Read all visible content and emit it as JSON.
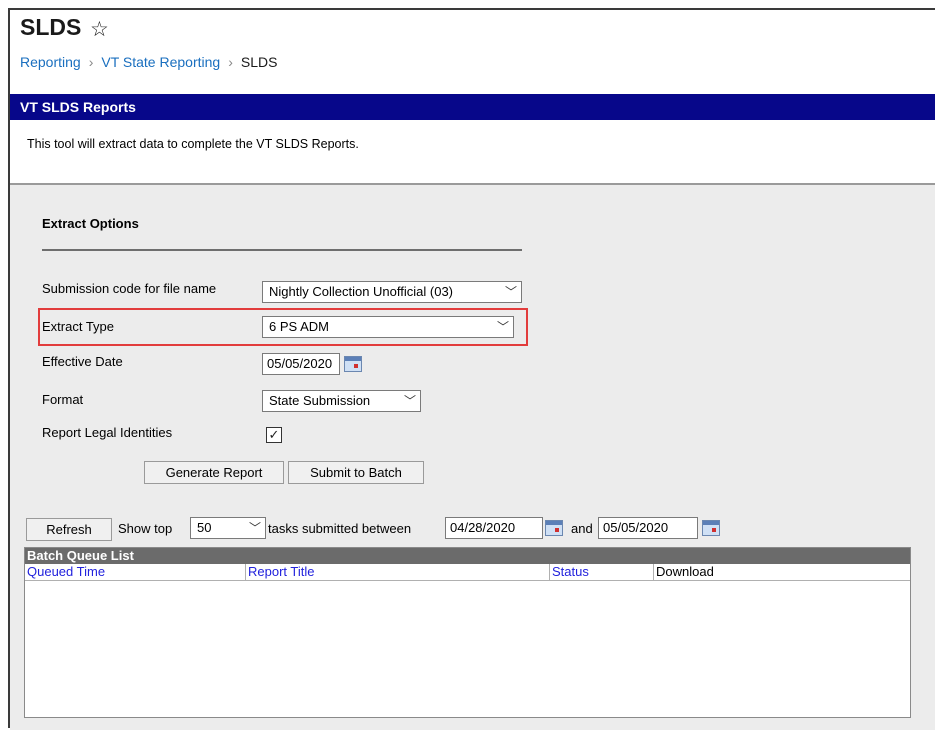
{
  "page": {
    "title": "SLDS",
    "breadcrumb": [
      "Reporting",
      "VT State Reporting",
      "SLDS"
    ]
  },
  "tool": {
    "header": "VT SLDS Reports",
    "description": "This tool will extract data to complete the VT SLDS Reports."
  },
  "extract_options": {
    "title": "Extract Options",
    "submission_code_label": "Submission code for file name",
    "submission_code_value": "Nightly Collection Unofficial (03)",
    "extract_type_label": "Extract Type",
    "extract_type_value": "6 PS ADM",
    "effective_date_label": "Effective Date",
    "effective_date_value": "05/05/2020",
    "format_label": "Format",
    "format_value": "State Submission",
    "report_legal_label": "Report Legal Identities",
    "report_legal_checked": true
  },
  "actions": {
    "generate": "Generate Report",
    "submit_batch": "Submit to Batch"
  },
  "batch_filter": {
    "refresh": "Refresh",
    "show_top_label": "Show top",
    "show_top_value": "50",
    "between_label": "tasks submitted between",
    "from_date": "04/28/2020",
    "and_label": "and",
    "to_date": "05/05/2020"
  },
  "batch_queue": {
    "title": "Batch Queue List",
    "columns": [
      "Queued Time",
      "Report Title",
      "Status",
      "Download"
    ]
  },
  "colors": {
    "header_bar": "#07078a",
    "link": "#1a6fbf",
    "highlight": "#e23c3c",
    "column_link": "#2222dd"
  }
}
